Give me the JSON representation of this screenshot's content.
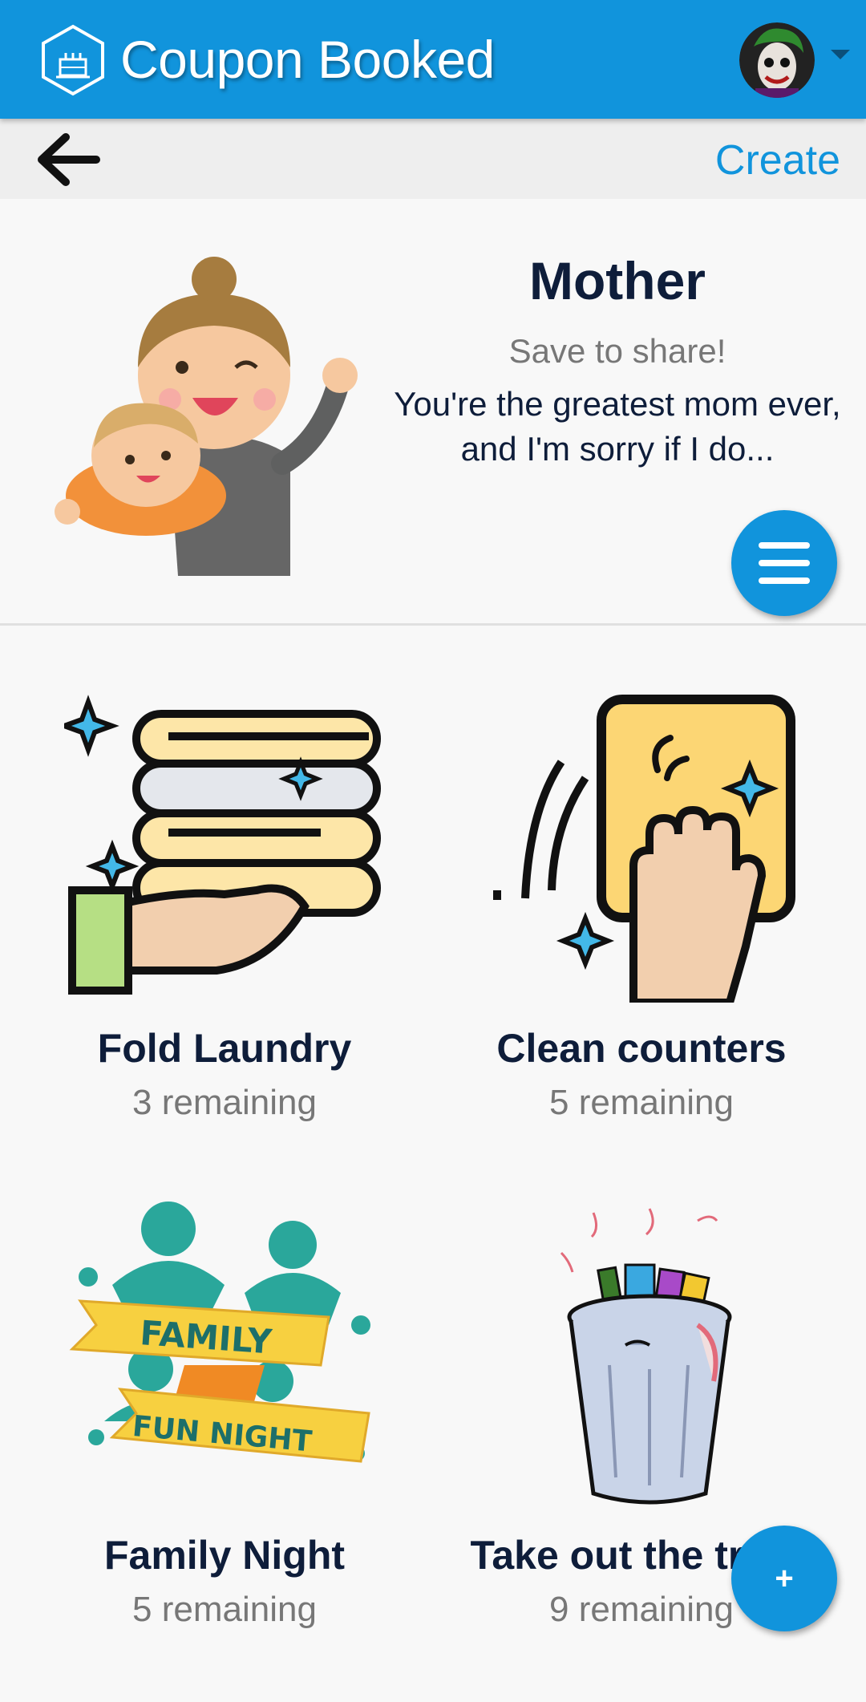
{
  "appbar": {
    "title": "Coupon Booked",
    "logo_icon": "cake-hexagon-icon",
    "avatar_icon": "joker-avatar",
    "caret_icon": "caret-down-icon",
    "brand_color": "#1194dc"
  },
  "subbar": {
    "back_icon": "arrow-left-icon",
    "create_label": "Create"
  },
  "book": {
    "title": "Mother",
    "save_note": "Save to share!",
    "description": "You're the greatest mom ever, and I'm sorry if I do...",
    "image_icon": "mother-and-baby-illustration",
    "menu_icon": "hamburger-menu-icon"
  },
  "coupons": [
    {
      "title": "Fold Laundry",
      "remaining": "3 remaining",
      "icon": "folded-laundry-icon"
    },
    {
      "title": "Clean counters",
      "remaining": "5 remaining",
      "icon": "cleaning-hand-icon"
    },
    {
      "title": "Family Night",
      "remaining": "5 remaining",
      "icon": "family-fun-night-icon",
      "banner_top": "FAMILY",
      "banner_bottom": "FUN NIGHT"
    },
    {
      "title": "Take out the trash",
      "remaining": "9 remaining",
      "icon": "trash-can-icon"
    }
  ],
  "fab": {
    "label": "+"
  }
}
